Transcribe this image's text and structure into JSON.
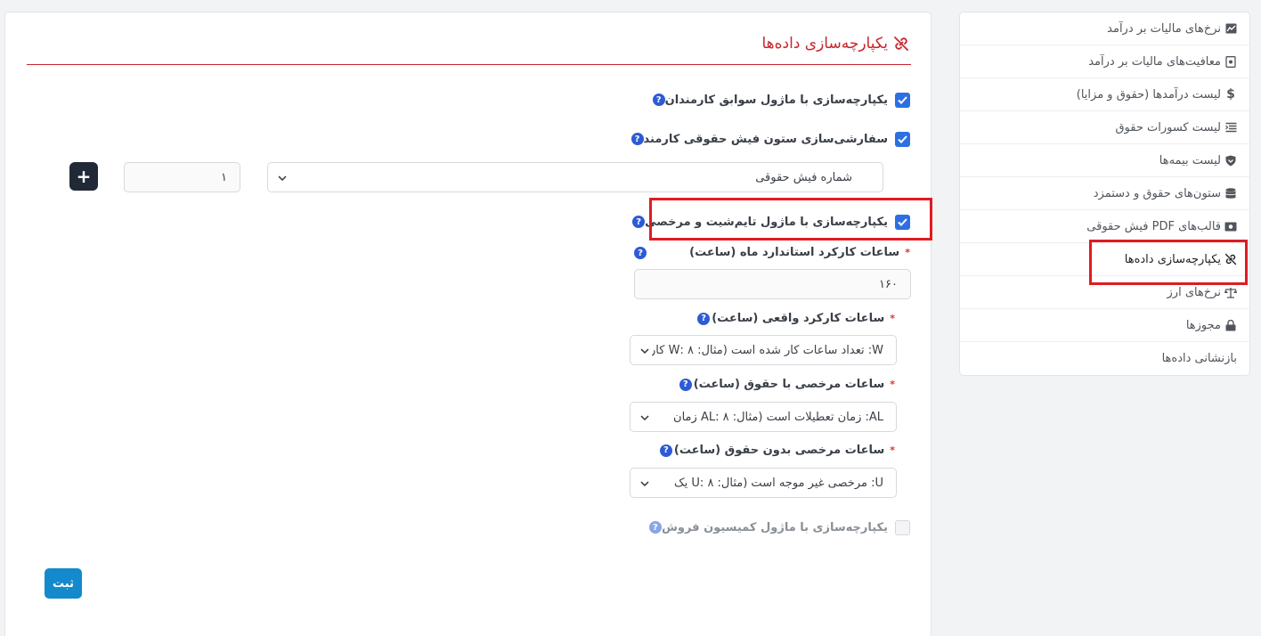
{
  "main": {
    "title": "یکپارچه‌سازی داده‌ها",
    "checks": [
      {
        "label": "یکپارچه‌سازی با ماژول سوابق کارمندان",
        "checked": true
      },
      {
        "label": "سفارشی‌سازی ستون فیش حقوقی کارمند",
        "checked": true
      },
      {
        "label": "یکپارچه‌سازی با ماژول تایم‌شیت و مرخصی",
        "checked": true
      },
      {
        "label": "یکپارچه‌سازی با ماژول کمیسیون فروش",
        "checked": false
      }
    ],
    "column_select": "شماره فیش حقوقی",
    "column_number": "۱",
    "add_label": "+",
    "fields": {
      "standard_hours": {
        "label": "ساعات کارکرد استاندارد ماه (ساعت)",
        "value": "۱۶۰"
      },
      "actual_hours": {
        "label": "ساعات کارکرد واقعی (ساعت)",
        "value": "W: تعداد ساعات کار شده است (مثال: ۸ :W کار"
      },
      "paid_leave": {
        "label": "ساعات مرخصی با حقوق (ساعت)",
        "value": "AL: زمان تعطیلات است (مثال: ۸ :AL زمان"
      },
      "unpaid_leave": {
        "label": "ساعات مرخصی بدون حقوق (ساعت)",
        "value": "U: مرخصی غیر موجه است (مثال: ۸ :U یک"
      }
    },
    "required_mark": "*",
    "help_mark": "?",
    "submit_label": "ثبت"
  },
  "sidebar": {
    "items": [
      {
        "label": "نرخ‌های مالیات بر درآمد",
        "icon": "chart-icon"
      },
      {
        "label": "معافیت‌های مالیات بر درآمد",
        "icon": "receipt-icon"
      },
      {
        "label": "لیست درآمدها (حقوق و مزایا)",
        "icon": "dollar-icon"
      },
      {
        "label": "لیست کسورات حقوق",
        "icon": "list-icon"
      },
      {
        "label": "لیست بیمه‌ها",
        "icon": "shield-icon"
      },
      {
        "label": "ستون‌های حقوق و دستمزد",
        "icon": "database-icon"
      },
      {
        "label": "قالب‌های PDF فیش حقوقی",
        "icon": "money-icon"
      },
      {
        "label": "یکپارچه‌سازی داده‌ها",
        "icon": "unlink-icon",
        "active": true
      },
      {
        "label": "نرخ‌های ارز",
        "icon": "scale-icon"
      },
      {
        "label": "مجوزها",
        "icon": "lock-icon"
      },
      {
        "label": "بازنشانی داده‌ها",
        "icon": ""
      }
    ]
  },
  "colors": {
    "accent": "#c8252c",
    "checkbox": "#2d6fe3",
    "highlight": "#e01b22",
    "submit": "#1489cc",
    "plus_button": "#212936"
  }
}
